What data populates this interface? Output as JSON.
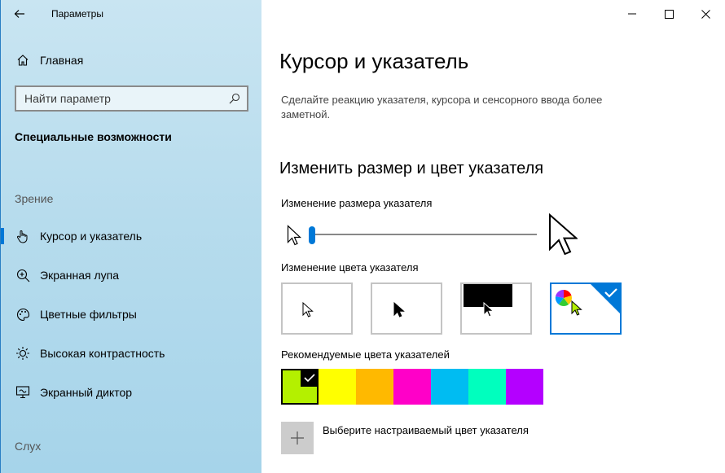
{
  "window": {
    "title": "Параметры",
    "back_icon": "arrow-left-icon",
    "controls": [
      "minimize-icon",
      "maximize-icon",
      "close-icon"
    ]
  },
  "sidebar": {
    "home_label": "Главная",
    "search_placeholder": "Найти параметр",
    "category_title": "Специальные возможности",
    "vision_header": "Зрение",
    "items": [
      {
        "label": "Курсор и указатель",
        "icon": "pointer-hand-icon",
        "active": true
      },
      {
        "label": "Экранная лупа",
        "icon": "magnifier-icon",
        "active": false
      },
      {
        "label": "Цветные фильтры",
        "icon": "palette-icon",
        "active": false
      },
      {
        "label": "Высокая контрастность",
        "icon": "contrast-sun-icon",
        "active": false
      },
      {
        "label": "Экранный диктор",
        "icon": "narrator-icon",
        "active": false
      }
    ],
    "hearing_header": "Слух"
  },
  "main": {
    "title": "Курсор и указатель",
    "description": "Сделайте реакцию указателя, курсора и сенсорного ввода более заметной.",
    "section_title": "Изменить размер и цвет указателя",
    "size_label": "Изменение размера указателя",
    "size_value": 1,
    "color_label": "Изменение цвета указателя",
    "color_options": [
      {
        "name": "white-pointer",
        "selected": false
      },
      {
        "name": "black-pointer",
        "selected": false
      },
      {
        "name": "inverted-pointer",
        "selected": false
      },
      {
        "name": "custom-pointer",
        "selected": true
      }
    ],
    "recommended_label": "Рекомендуемые цвета указателей",
    "recommended_colors": [
      "#B4F000",
      "#FFFF00",
      "#FFB900",
      "#FF00C8",
      "#00BCF2",
      "#00FFBE",
      "#B400FF"
    ],
    "recommended_selected_index": 0,
    "custom_color_label": "Выберите настраиваемый цвет указателя",
    "accent": "#0078D7"
  }
}
